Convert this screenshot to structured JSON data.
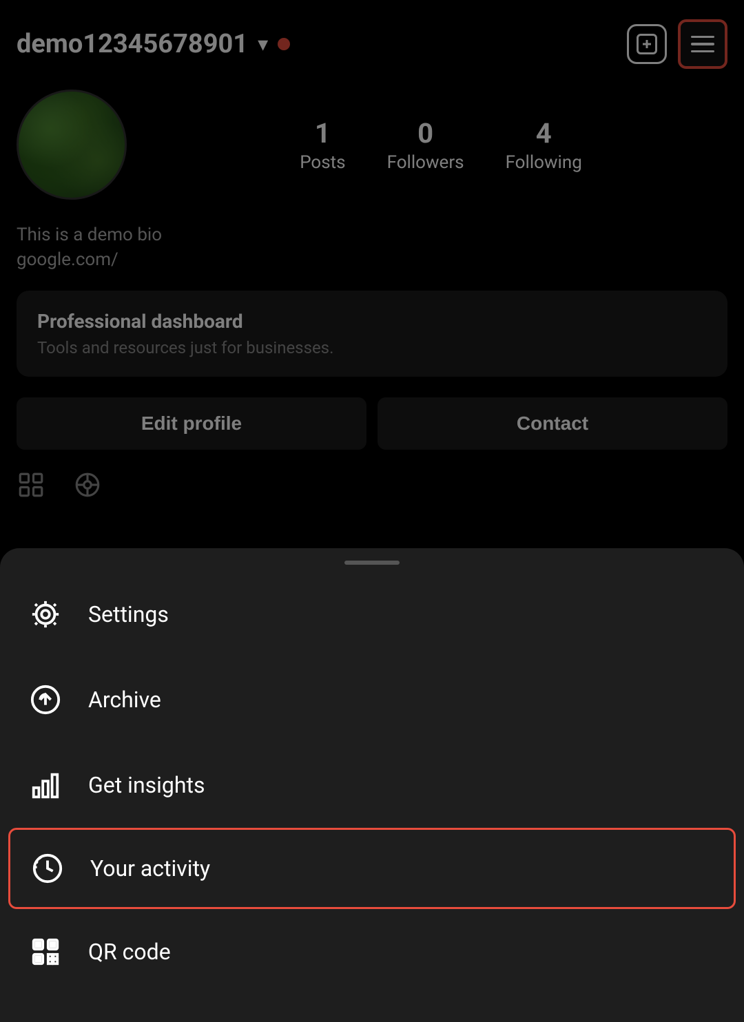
{
  "header": {
    "username": "demo12345678901",
    "chevron": "▾",
    "add_button_label": "+",
    "menu_button_label": "menu"
  },
  "profile": {
    "posts_count": "1",
    "posts_label": "Posts",
    "followers_count": "0",
    "followers_label": "Followers",
    "following_count": "4",
    "following_label": "Following",
    "bio_text": "This is a demo bio",
    "bio_link": "google.com/"
  },
  "pro_dashboard": {
    "title": "Professional dashboard",
    "subtitle": "Tools and resources just for businesses."
  },
  "action_buttons": {
    "edit_profile": "Edit profile",
    "contact": "Contact"
  },
  "menu": {
    "handle": "",
    "items": [
      {
        "id": "settings",
        "label": "Settings",
        "icon": "settings"
      },
      {
        "id": "archive",
        "label": "Archive",
        "icon": "archive"
      },
      {
        "id": "insights",
        "label": "Get insights",
        "icon": "insights"
      },
      {
        "id": "activity",
        "label": "Your activity",
        "icon": "activity",
        "highlighted": true
      },
      {
        "id": "qrcode",
        "label": "QR code",
        "icon": "qrcode"
      }
    ]
  }
}
